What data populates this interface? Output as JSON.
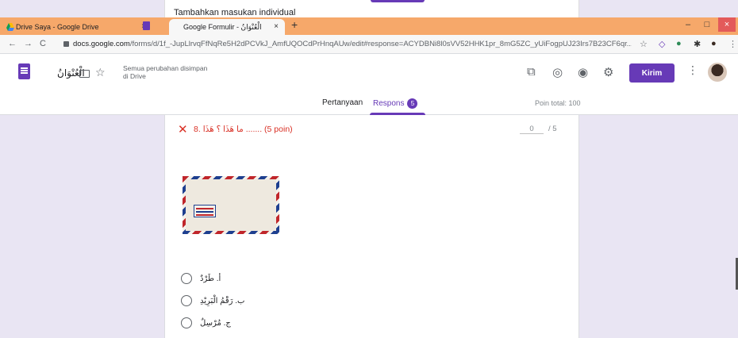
{
  "behind": {
    "title": "Tambahkan masukan individual"
  },
  "browser": {
    "tabs": [
      {
        "label": "Drive Saya - Google Drive",
        "close": "×"
      },
      {
        "label": "Google Formulir - الْعُنْوَانُ",
        "close": "×"
      }
    ],
    "new_tab": "+",
    "window": {
      "minimize": "–",
      "maximize": "□",
      "close": "×"
    },
    "url_prefix": "docs.google.com",
    "url_rest": "/forms/d/1f_-JupLlrvqFfNqRe5H2dPCVkJ_AmfUQOCdPrHnqAUw/edit#response=ACYDBNi8l0sVV52HHK1pr_8mG5ZC_yUiFogpUJ23Irs7B23CF6qr..."
  },
  "form": {
    "title": "الْعُنْوَانُ",
    "save_status_line1": "Semua perubahan disimpan",
    "save_status_line2": "di Drive",
    "send_label": "Kirim",
    "tabs": {
      "questions": "Pertanyaan",
      "responses": "Respons",
      "responses_count": "5"
    },
    "points_total": "Poin total: 100"
  },
  "question": {
    "title": "8. ما هَذَا ؟ هَذَا ....... (5 poin)",
    "score_value": "0",
    "score_max": "/ 5",
    "options": [
      "أ. طَرْدٌ",
      "ب. رَقْمُ الْبَرِيْدِ",
      "ج. مُرْسِلٌ"
    ]
  },
  "colors": {
    "accent": "#673ab7",
    "wrong": "#d93025",
    "tabstrip": "#f6a86a",
    "page_bg": "#e9e5f3"
  }
}
